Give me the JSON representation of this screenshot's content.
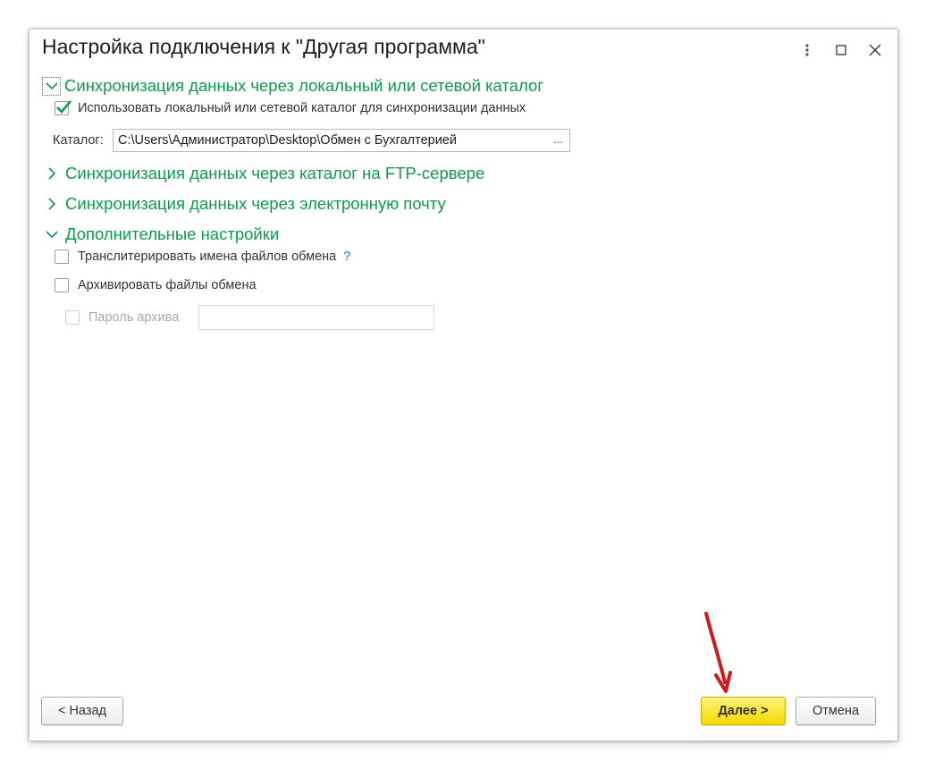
{
  "window": {
    "title": "Настройка подключения к \"Другая программа\""
  },
  "icons": {
    "more": "more-vertical-icon",
    "maximize": "maximize-icon",
    "close": "close-icon",
    "expanded": "chevron-down-icon",
    "collapsed": "chevron-right-icon",
    "checkmark": "checkmark-icon"
  },
  "sections": {
    "local": {
      "title": "Синхронизация данных через локальный или сетевой каталог",
      "expanded": true,
      "use_checkbox_label": "Использовать локальный или сетевой каталог для синхронизации данных",
      "use_checked": true,
      "catalog_label": "Каталог:",
      "catalog_value": "C:\\Users\\Администратор\\Desktop\\Обмен с Бухгалтерией",
      "browse_label": "..."
    },
    "ftp": {
      "title": "Синхронизация данных через каталог на FTP-сервере",
      "expanded": false
    },
    "email": {
      "title": "Синхронизация данных через электронную почту",
      "expanded": false
    },
    "extra": {
      "title": "Дополнительные настройки",
      "expanded": true,
      "transliterate_label": "Транслитерировать имена файлов обмена",
      "transliterate_checked": false,
      "help_label": "?",
      "archive_label": "Архивировать файлы обмена",
      "archive_checked": false,
      "password_label": "Пароль архива",
      "password_checked": false,
      "password_value": ""
    }
  },
  "footer": {
    "back_label": "< Назад",
    "next_label": "Далее >",
    "cancel_label": "Отмена"
  },
  "colors": {
    "section_title": "#0c9a4d",
    "checkmark": "#0c9a4d",
    "primary_button": "#f5d800",
    "help": "#2a6fd1",
    "annotation_arrow": "#d01a1a"
  }
}
